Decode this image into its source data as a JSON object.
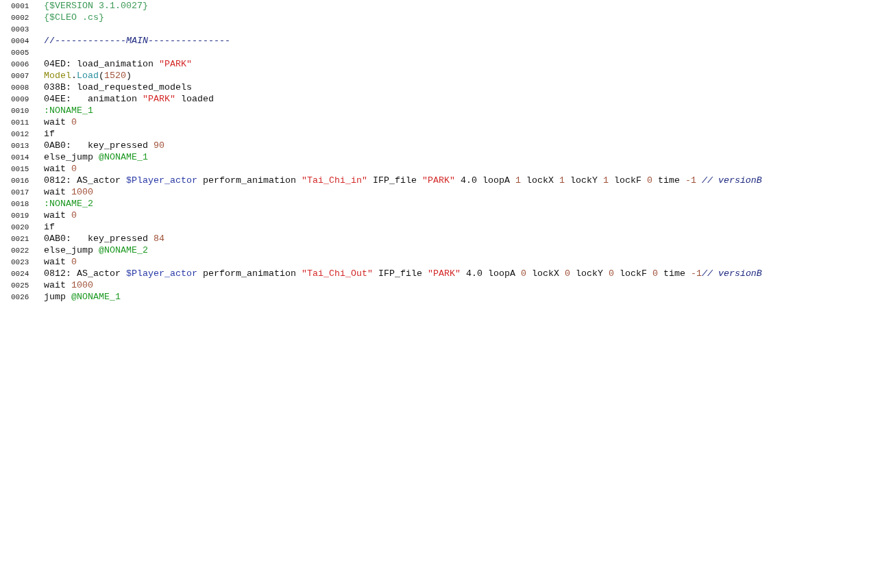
{
  "editor": {
    "lines": [
      {
        "number": "0001",
        "tokens": [
          {
            "text": "{$VERSION 3.1.0027}",
            "kind": "directive"
          }
        ]
      },
      {
        "number": "0002",
        "tokens": [
          {
            "text": "{$CLEO .cs}",
            "kind": "directive"
          }
        ]
      },
      {
        "number": "0003"
      },
      {
        "number": "0004",
        "tokens": [
          {
            "text": "//-------------",
            "kind": "comment"
          },
          {
            "text": "MAIN",
            "kind": "comment-italic"
          },
          {
            "text": "---------------",
            "kind": "comment"
          }
        ]
      },
      {
        "number": "0005"
      },
      {
        "number": "0006",
        "tokens": [
          {
            "text": "04ED: load_animation ",
            "kind": "plain"
          },
          {
            "text": "\"PARK\"",
            "kind": "string"
          }
        ]
      },
      {
        "number": "0007",
        "tokens": [
          {
            "text": "Model",
            "kind": "class"
          },
          {
            "text": ".",
            "kind": "plain"
          },
          {
            "text": "Load",
            "kind": "method"
          },
          {
            "text": "(",
            "kind": "plain"
          },
          {
            "text": "1520",
            "kind": "number"
          },
          {
            "text": ")",
            "kind": "plain"
          }
        ]
      },
      {
        "number": "0008",
        "tokens": [
          {
            "text": "038B: load_requested_models",
            "kind": "plain"
          }
        ]
      },
      {
        "number": "0009",
        "tokens": [
          {
            "text": "04EE:   animation ",
            "kind": "plain"
          },
          {
            "text": "\"PARK\"",
            "kind": "string"
          },
          {
            "text": " loaded",
            "kind": "plain"
          }
        ]
      },
      {
        "number": "0010",
        "tokens": [
          {
            "text": ":NONAME_1",
            "kind": "label"
          }
        ]
      },
      {
        "number": "0011",
        "tokens": [
          {
            "text": "wait ",
            "kind": "plain"
          },
          {
            "text": "0",
            "kind": "number"
          }
        ]
      },
      {
        "number": "0012",
        "tokens": [
          {
            "text": "if",
            "kind": "plain"
          }
        ]
      },
      {
        "number": "0013",
        "tokens": [
          {
            "text": "0AB0:   key_pressed ",
            "kind": "plain"
          },
          {
            "text": "90",
            "kind": "number"
          }
        ]
      },
      {
        "number": "0014",
        "tokens": [
          {
            "text": "else_jump ",
            "kind": "plain"
          },
          {
            "text": "@NONAME_1",
            "kind": "label"
          }
        ]
      },
      {
        "number": "0015",
        "tokens": [
          {
            "text": "wait ",
            "kind": "plain"
          },
          {
            "text": "0",
            "kind": "number"
          }
        ]
      },
      {
        "number": "0016",
        "tokens": [
          {
            "text": "0812: AS_actor ",
            "kind": "plain"
          },
          {
            "text": "$Player_actor",
            "kind": "variable"
          },
          {
            "text": " perform_animation ",
            "kind": "plain"
          },
          {
            "text": "\"Tai_Chi_in\"",
            "kind": "string"
          },
          {
            "text": " IFP_file ",
            "kind": "plain"
          },
          {
            "text": "\"PARK\"",
            "kind": "string"
          },
          {
            "text": " 4.0 loopA ",
            "kind": "plain"
          },
          {
            "text": "1",
            "kind": "number"
          },
          {
            "text": " lockX ",
            "kind": "plain"
          },
          {
            "text": "1",
            "kind": "number"
          },
          {
            "text": " lockY ",
            "kind": "plain"
          },
          {
            "text": "1",
            "kind": "number"
          },
          {
            "text": " lockF ",
            "kind": "plain"
          },
          {
            "text": "0",
            "kind": "number"
          },
          {
            "text": " time ",
            "kind": "plain"
          },
          {
            "text": "-1",
            "kind": "number"
          },
          {
            "text": " // versionB",
            "kind": "comment-italic"
          }
        ]
      },
      {
        "number": "0017",
        "tokens": [
          {
            "text": "wait ",
            "kind": "plain"
          },
          {
            "text": "1000",
            "kind": "number"
          }
        ]
      },
      {
        "number": "0018",
        "tokens": [
          {
            "text": ":NONAME_2",
            "kind": "label"
          }
        ]
      },
      {
        "number": "0019",
        "tokens": [
          {
            "text": "wait ",
            "kind": "plain"
          },
          {
            "text": "0",
            "kind": "number"
          }
        ]
      },
      {
        "number": "0020",
        "tokens": [
          {
            "text": "if",
            "kind": "plain"
          }
        ]
      },
      {
        "number": "0021",
        "tokens": [
          {
            "text": "0AB0:   key_pressed ",
            "kind": "plain"
          },
          {
            "text": "84",
            "kind": "number"
          }
        ]
      },
      {
        "number": "0022",
        "tokens": [
          {
            "text": "else_jump ",
            "kind": "plain"
          },
          {
            "text": "@NONAME_2",
            "kind": "label"
          }
        ]
      },
      {
        "number": "0023",
        "tokens": [
          {
            "text": "wait ",
            "kind": "plain"
          },
          {
            "text": "0",
            "kind": "number"
          }
        ]
      },
      {
        "number": "0024",
        "tokens": [
          {
            "text": "0812: AS_actor ",
            "kind": "plain"
          },
          {
            "text": "$Player_actor",
            "kind": "variable"
          },
          {
            "text": " perform_animation ",
            "kind": "plain"
          },
          {
            "text": "\"Tai_Chi_Out\"",
            "kind": "string"
          },
          {
            "text": " IFP_file ",
            "kind": "plain"
          },
          {
            "text": "\"PARK\"",
            "kind": "string"
          },
          {
            "text": " 4.0 loopA ",
            "kind": "plain"
          },
          {
            "text": "0",
            "kind": "number"
          },
          {
            "text": " lockX ",
            "kind": "plain"
          },
          {
            "text": "0",
            "kind": "number"
          },
          {
            "text": " lockY ",
            "kind": "plain"
          },
          {
            "text": "0",
            "kind": "number"
          },
          {
            "text": " lockF ",
            "kind": "plain"
          },
          {
            "text": "0",
            "kind": "number"
          },
          {
            "text": " time ",
            "kind": "plain"
          },
          {
            "text": "-1",
            "kind": "number"
          },
          {
            "text": "// versionB",
            "kind": "comment-italic"
          }
        ]
      },
      {
        "number": "0025",
        "tokens": [
          {
            "text": "wait ",
            "kind": "plain"
          },
          {
            "text": "1000",
            "kind": "number"
          }
        ]
      },
      {
        "number": "0026",
        "tokens": [
          {
            "text": "jump ",
            "kind": "plain"
          },
          {
            "text": "@NONAME_1",
            "kind": "label"
          }
        ]
      }
    ]
  }
}
